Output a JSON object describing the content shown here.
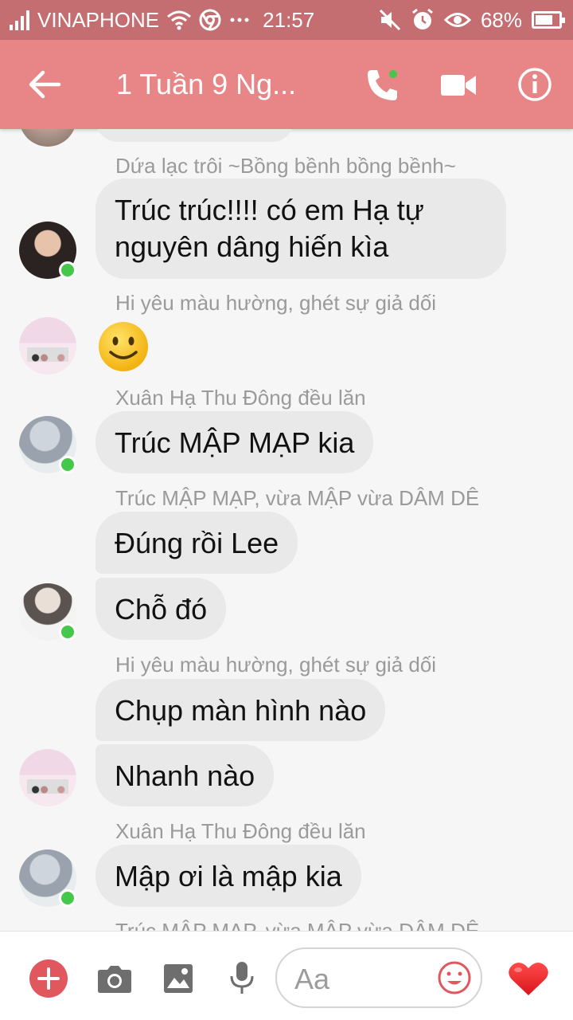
{
  "status_bar": {
    "carrier": "VINAPHONE",
    "time": "21:57",
    "battery": "68%",
    "icons": [
      "signal-icon",
      "wifi-icon",
      "chrome-icon",
      "more-icon",
      "mute-icon",
      "alarm-icon",
      "eye-icon",
      "battery-icon"
    ]
  },
  "header": {
    "title": "1 Tuần 9 Ng...",
    "icons": [
      "back-arrow-icon",
      "phone-call-icon",
      "video-camera-icon",
      "info-icon"
    ]
  },
  "messages": [
    {
      "sender": "Dứa lạc trôi ~Bồng bềnh bồng bềnh~",
      "texts": [
        "Trúc trúc!!!! có em Hạ tự",
        "nguyên dâng hiến kìa"
      ]
    },
    {
      "sender": "Hi yêu màu hường, ghét sự giả dối",
      "emoji": "smiley-emoji"
    },
    {
      "sender": "Xuân Hạ Thu Đông đều lăn",
      "texts": [
        "Trúc MẬP MẠP kia"
      ]
    },
    {
      "sender": "Trúc MẬP MẠP, vừa MẬP vừa DÂM DÊ",
      "texts": [
        "Đúng rồi Lee",
        "Chỗ đó"
      ]
    },
    {
      "sender": "Hi yêu màu hường, ghét sự giả dối",
      "texts": [
        "Chụp màn hình nào",
        "Nhanh nào"
      ]
    },
    {
      "sender": "Xuân Hạ Thu Đông đều lăn",
      "texts": [
        "Mập ơi là mập kia"
      ]
    },
    {
      "sender": "Trúc MẬP MẠP, vừa MẬP vừa DÂM DÊ"
    }
  ],
  "composer": {
    "placeholder": "Aa",
    "icons": [
      "add-icon",
      "camera-icon",
      "image-icon",
      "microphone-icon",
      "emoji-icon",
      "heart-icon"
    ]
  },
  "colors": {
    "header": "#e88587",
    "status_bar": "#c56e72",
    "bubble": "#e9e9e9",
    "online": "#44c74a",
    "accent": "#e0585e"
  }
}
